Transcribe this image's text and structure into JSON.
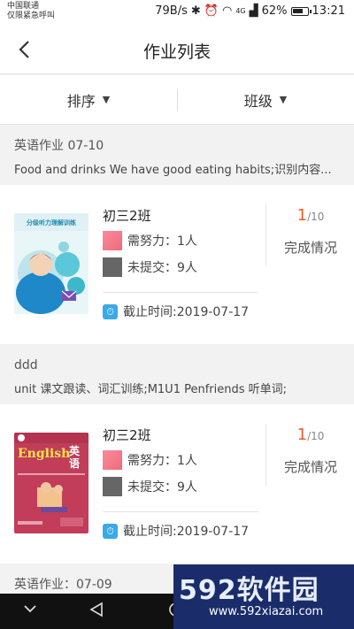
{
  "status_bar": {
    "carrier": "中国联通",
    "carrier_note": "仅限紧急呼叫",
    "speed": "79B/s",
    "signal": "4G",
    "battery": "62%",
    "time": "13:21"
  },
  "nav": {
    "title": "作业列表",
    "back_icon": "chevron-left-icon"
  },
  "filters": [
    {
      "label": "排序",
      "caret": "▼"
    },
    {
      "label": "班级",
      "caret": "▼"
    }
  ],
  "sections": [
    {
      "title": "英语作业 07-10",
      "subtitle": "Food and drinks We have good eating habits;识别内容...",
      "card": {
        "class_name": "初三2班",
        "need_effort": "需努力：1人",
        "not_submitted": "未提交：9人",
        "deadline": "截止时间:2019-07-17",
        "completed": "1",
        "total": "/10",
        "status_label": "完成情况",
        "cover": {
          "title": "分级听力理解训练"
        }
      }
    },
    {
      "title": "ddd",
      "subtitle": "unit 课文跟读、词汇训练;M1U1 Penfriends 听单词;",
      "card": {
        "class_name": "初三2班",
        "need_effort": "需努力：1人",
        "not_submitted": "未提交：9人",
        "deadline": "截止时间:2019-07-17",
        "completed": "1",
        "total": "/10",
        "status_label": "完成情况",
        "cover": {
          "word_en": "English",
          "word_cn": "英语"
        }
      }
    },
    {
      "title": "英语作业：07-09"
    }
  ],
  "bottom_nav": {
    "icons": [
      "chevron-down-icon",
      "back-triangle-icon",
      "home-circle-icon"
    ]
  },
  "watermark": {
    "big": "592软件园",
    "small": "www.592xiazai.com"
  }
}
